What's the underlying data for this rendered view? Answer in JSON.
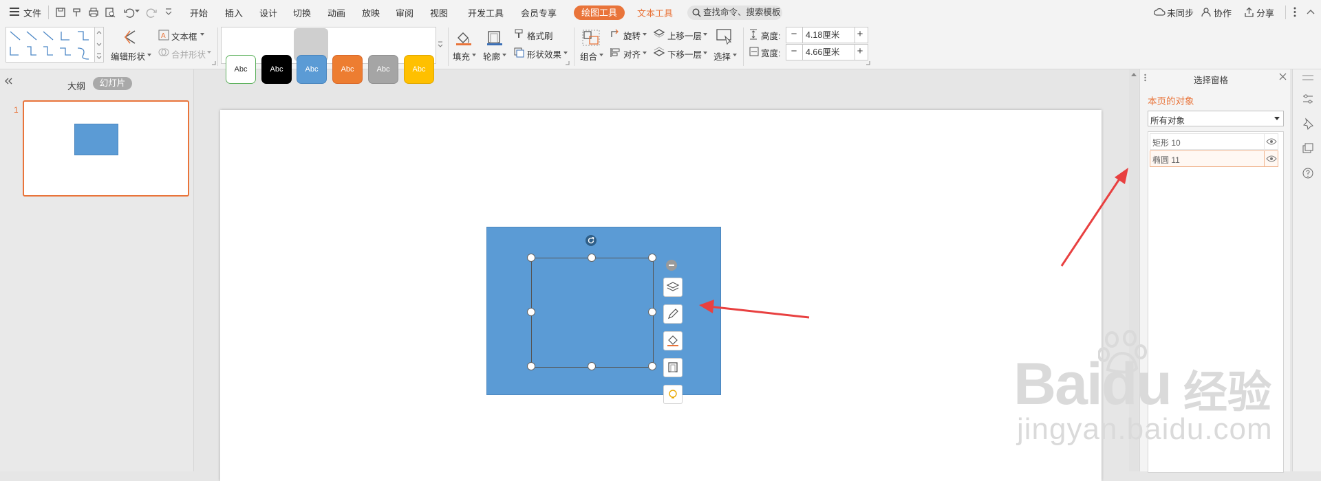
{
  "menubar": {
    "file": "文件",
    "tabs": [
      "开始",
      "插入",
      "设计",
      "切换",
      "动画",
      "放映",
      "审阅",
      "视图",
      "开发工具",
      "会员专享"
    ],
    "drawing_tools": "绘图工具",
    "text_tools": "文本工具",
    "search_placeholder": "查找命令、搜索模板",
    "unsynced": "未同步",
    "collaborate": "协作",
    "share": "分享"
  },
  "ribbon": {
    "edit_shape": "编辑形状",
    "textbox": "文本框",
    "merge_shape": "合并形状",
    "style_swatches": [
      {
        "label": "Abc",
        "bg": "#ffffff",
        "fg": "#333333",
        "border": "#5fb25f"
      },
      {
        "label": "Abc",
        "bg": "#000000",
        "fg": "#ffffff",
        "border": "#000000"
      },
      {
        "label": "Abc",
        "bg": "#5b9bd5",
        "fg": "#ffffff",
        "border": "#4a86be"
      },
      {
        "label": "Abc",
        "bg": "#ed7d31",
        "fg": "#ffffff",
        "border": "#d9692a"
      },
      {
        "label": "Abc",
        "bg": "#a5a5a5",
        "fg": "#ffffff",
        "border": "#909090"
      },
      {
        "label": "Abc",
        "bg": "#ffc000",
        "fg": "#ffffff",
        "border": "#e0a800"
      }
    ],
    "fill": "填充",
    "outline": "轮廓",
    "format_painter": "格式刷",
    "shape_effects": "形状效果",
    "group": "组合",
    "rotate": "旋转",
    "align": "对齐",
    "bring_forward": "上移一层",
    "send_backward": "下移一层",
    "select": "选择",
    "height_label": "高度:",
    "height_value": "4.18厘米",
    "width_label": "宽度:",
    "width_value": "4.66厘米"
  },
  "left_panel": {
    "outline_tab": "大纲",
    "slides_tab": "幻灯片",
    "slide_number": "1"
  },
  "selection_pane": {
    "title": "选择窗格",
    "section": "本页的对象",
    "filter": "所有对象",
    "objects": [
      "矩形 10",
      "椭圆 11"
    ]
  },
  "watermark": {
    "brand": "Baidu",
    "brand_cn": "经验",
    "url": "jingyan.baidu.com"
  },
  "colors": {
    "accent": "#e9743a",
    "shape_fill": "#5b9bd5",
    "arrow": "#e84040"
  }
}
